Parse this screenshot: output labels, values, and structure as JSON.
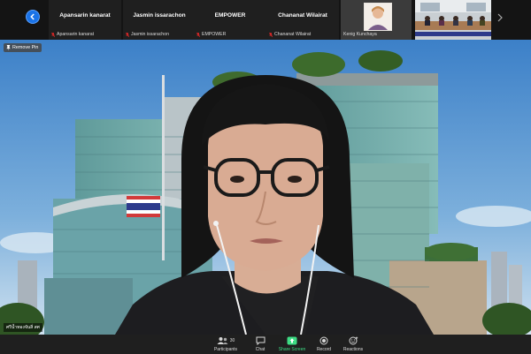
{
  "thumbnail_strip": {
    "tiles": [
      {
        "name": "Apansarin kanarat",
        "label": "Apansarin kanarat"
      },
      {
        "name": "Jasmin issarachon",
        "label": "Jasmin issarachon"
      },
      {
        "name": "EMPOWER",
        "label": "EMPOWER"
      },
      {
        "name": "Chananat Wilairat",
        "label": "Chananat Wilairat"
      }
    ],
    "video_tiles": [
      {
        "label": "Kenig Kunchaya"
      },
      {
        "label": ""
      }
    ]
  },
  "main_video": {
    "remove_pin_label": "Remove Pin",
    "speaker_name": "ศรีน้ำทองจันสิ่ สศ"
  },
  "toolbar": {
    "participants_label": "Participants",
    "participants_count": "30",
    "chat_label": "Chat",
    "share_screen_label": "Share Screen",
    "record_label": "Record",
    "reactions_label": "Reactions"
  },
  "colors": {
    "accent": "#1a73e8",
    "share_green": "#3ddc84",
    "mic_muted_red": "#e02828",
    "toolbar_bg": "#1f1f1f"
  }
}
